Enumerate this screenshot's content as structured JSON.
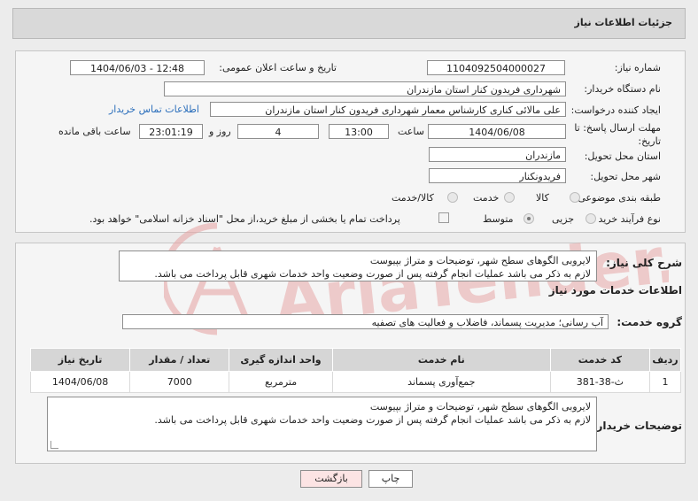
{
  "header": {
    "title": "جزئیات اطلاعات نیاز"
  },
  "form": {
    "need_number_label": "شماره نیاز:",
    "need_number": "1104092504000027",
    "announce_label": "تاریخ و ساعت اعلان عمومی:",
    "announce_value": "1404/06/03 - 12:48",
    "buyer_org_label": "نام دستگاه خریدار:",
    "buyer_org": "شهرداری فریدون کنار استان مازندران",
    "creator_label": "ایجاد کننده درخواست:",
    "creator": "علی مالائی کناری کارشناس معمار شهرداری فریدون کنار استان مازندران",
    "contact_link": "اطلاعات تماس خریدار",
    "deadline_label_1": "مهلت ارسال پاسخ: تا",
    "deadline_label_2": "تاریخ:",
    "deadline_date": "1404/06/08",
    "time_label": "ساعت",
    "deadline_time": "13:00",
    "days_value": "4",
    "days_label": "روز و",
    "remaining_time": "23:01:19",
    "remaining_label": "ساعت باقی مانده",
    "province_label": "استان محل تحویل:",
    "province": "مازندران",
    "city_label": "شهر محل تحویل:",
    "city": "فریدونکنار",
    "category_label": "طبقه بندی موضوعی:",
    "category_options": [
      "کالا",
      "خدمت",
      "کالا/خدمت"
    ],
    "category_selected": "خدمت",
    "process_label": "نوع فرآیند خرید :",
    "process_options": [
      "جزیی",
      "متوسط"
    ],
    "process_selected": "متوسط",
    "payment_note": "پرداخت تمام یا بخشی از مبلغ خرید،از محل \"اسناد خزانه اسلامی\" خواهد بود."
  },
  "summary": {
    "label": "شرح کلی نیاز:",
    "text": "لایروبی الگوهای سطح شهر، توضیحات و متراژ بپیوست\nلازم به ذکر می باشد عملیات انجام گرفته پس از صورت وضعیت واحد خدمات شهری قابل پرداخت می باشد."
  },
  "services": {
    "section_title": "اطلاعات خدمات مورد نیاز",
    "group_label": "گروه خدمت:",
    "group_value": "آب رسانی؛ مدیریت پسماند، فاضلاب و فعالیت های تصفیه",
    "columns": [
      "ردیف",
      "کد خدمت",
      "نام خدمت",
      "واحد اندازه گیری",
      "تعداد / مقدار",
      "تاریخ نیاز"
    ],
    "rows": [
      [
        "1",
        "ث-38-381",
        "جمع‌آوری پسماند",
        "مترمربع",
        "7000",
        "1404/06/08"
      ]
    ]
  },
  "buyer_notes": {
    "label": "توضیحات خریدار:",
    "text": "لایروبی الگوهای سطح شهر، توضیحات و متراژ بپیوست\nلازم به ذکر می باشد عملیات انجام گرفته پس از صورت وضعیت واحد خدمات شهری قابل پرداخت می باشد."
  },
  "buttons": {
    "print": "چاپ",
    "back": "بازگشت"
  },
  "watermark": {
    "text": "AriaTender.neT"
  },
  "colors": {
    "accent_link": "#2a6ebb",
    "back_button_bg": "#fce4e4",
    "watermark": "#e7a8a8"
  }
}
